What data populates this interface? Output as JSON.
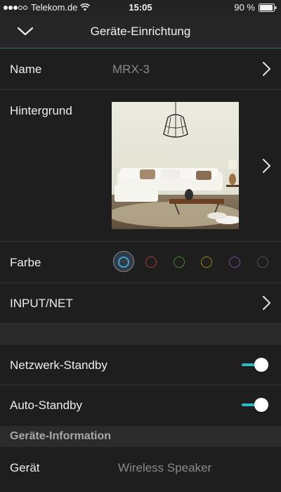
{
  "status_bar": {
    "carrier": "Telekom.de",
    "time": "15:05",
    "battery": "90 %"
  },
  "nav": {
    "title": "Geräte-Einrichtung",
    "back_icon": "chevron-down-icon"
  },
  "settings": {
    "name": {
      "label": "Name",
      "value": "MRX-3"
    },
    "background": {
      "label": "Hintergrund"
    },
    "color": {
      "label": "Farbe",
      "options": [
        {
          "name": "blue",
          "hex": "#4a9bd0",
          "selected": true
        },
        {
          "name": "red",
          "hex": "#b03a3a",
          "selected": false
        },
        {
          "name": "green",
          "hex": "#4a8a3a",
          "selected": false
        },
        {
          "name": "yellow",
          "hex": "#a08a20",
          "selected": false
        },
        {
          "name": "purple",
          "hex": "#7a4a9a",
          "selected": false
        },
        {
          "name": "gray",
          "hex": "#555555",
          "selected": false
        }
      ]
    },
    "input": {
      "label": "INPUT/NET"
    },
    "network_standby": {
      "label": "Netzwerk-Standby",
      "enabled": true
    },
    "auto_standby": {
      "label": "Auto-Standby",
      "enabled": true
    }
  },
  "device_info": {
    "header": "Geräte-Information",
    "device": {
      "label": "Gerät",
      "value": "Wireless Speaker"
    }
  },
  "colors": {
    "accent": "#2fb8c0",
    "background": "#1e1e1e",
    "header_bg": "#262626"
  }
}
